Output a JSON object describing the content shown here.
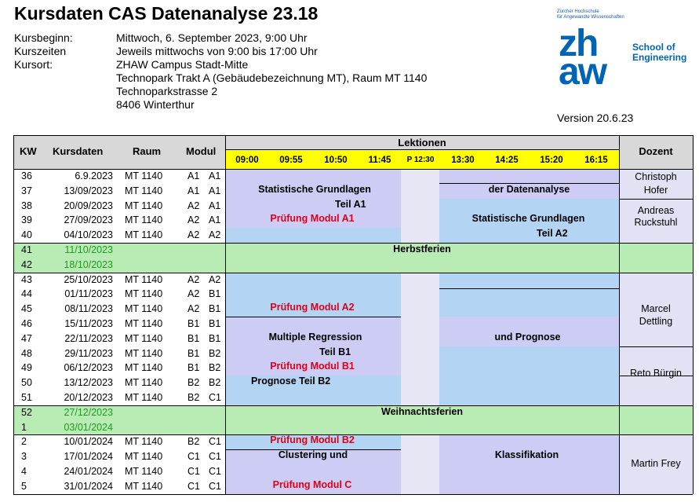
{
  "title": "Kursdaten CAS Datenanalyse 23.18",
  "info": [
    {
      "label": "Kursbeginn:",
      "value": "Mittwoch, 6. September 2023, 9:00 Uhr"
    },
    {
      "label": "Kurszeiten",
      "value": "Jeweils mittwochs von 9:00 bis 17:00 Uhr"
    },
    {
      "label": "Kursort:",
      "value": "ZHAW Campus Stadt-Mitte"
    },
    {
      "label": "",
      "value": "Technopark Trakt A (Gebäudebezeichnung MT), Raum MT 1140"
    },
    {
      "label": "",
      "value": "Technoparkstrasse 2"
    },
    {
      "label": "",
      "value": "8406 Winterthur"
    }
  ],
  "logo": {
    "small_line1": "Zürcher Hochschule",
    "small_line2": "für Angewandte Wissenschaften",
    "mark_top": "zh",
    "mark_bottom": "aw",
    "school_line1": "School of",
    "school_line2": "Engineering",
    "color": "#0064b4"
  },
  "version": "Version 20.6.23",
  "table": {
    "headers": {
      "kw": "KW",
      "kursdaten": "Kursdaten",
      "raum": "Raum",
      "modul": "Modul",
      "lektionen": "Lektionen",
      "dozent": "Dozent"
    },
    "times": [
      "09:00",
      "09:55",
      "10:50",
      "11:45",
      "P 12:30",
      "13:30",
      "14:25",
      "15:20",
      "16:15"
    ],
    "rows": [
      {
        "kw": "36",
        "date": "6.9.2023",
        "raum": "MT 1140",
        "m1": "A1",
        "m2": "A1"
      },
      {
        "kw": "37",
        "date": "13/09/2023",
        "raum": "MT 1140",
        "m1": "A1",
        "m2": "A1"
      },
      {
        "kw": "38",
        "date": "20/09/2023",
        "raum": "MT 1140",
        "m1": "A2",
        "m2": "A1"
      },
      {
        "kw": "39",
        "date": "27/09/2023",
        "raum": "MT 1140",
        "m1": "A2",
        "m2": "A1"
      },
      {
        "kw": "40",
        "date": "04/10/2023",
        "raum": "MT 1140",
        "m1": "A2",
        "m2": "A2"
      },
      {
        "kw": "41",
        "date": "11/10/2023",
        "raum": "",
        "m1": "",
        "m2": ""
      },
      {
        "kw": "42",
        "date": "18/10/2023",
        "raum": "",
        "m1": "",
        "m2": ""
      },
      {
        "kw": "43",
        "date": "25/10/2023",
        "raum": "MT 1140",
        "m1": "A2",
        "m2": "A2"
      },
      {
        "kw": "44",
        "date": "01/11/2023",
        "raum": "MT 1140",
        "m1": "A2",
        "m2": "B1"
      },
      {
        "kw": "45",
        "date": "08/11/2023",
        "raum": "MT 1140",
        "m1": "A2",
        "m2": "B1"
      },
      {
        "kw": "46",
        "date": "15/11/2023",
        "raum": "MT 1140",
        "m1": "B1",
        "m2": "B1"
      },
      {
        "kw": "47",
        "date": "22/11/2023",
        "raum": "MT 1140",
        "m1": "B1",
        "m2": "B1"
      },
      {
        "kw": "48",
        "date": "29/11/2023",
        "raum": "MT 1140",
        "m1": "B1",
        "m2": "B2"
      },
      {
        "kw": "49",
        "date": "06/12/2023",
        "raum": "MT 1140",
        "m1": "B1",
        "m2": "B2"
      },
      {
        "kw": "50",
        "date": "13/12/2023",
        "raum": "MT 1140",
        "m1": "B2",
        "m2": "B2"
      },
      {
        "kw": "51",
        "date": "20/12/2023",
        "raum": "MT 1140",
        "m1": "B2",
        "m2": "C1"
      },
      {
        "kw": "52",
        "date": "27/12/2023",
        "raum": "",
        "m1": "",
        "m2": ""
      },
      {
        "kw": "1",
        "date": "03/01/2024",
        "raum": "",
        "m1": "",
        "m2": ""
      },
      {
        "kw": "2",
        "date": "10/01/2024",
        "raum": "MT 1140",
        "m1": "B2",
        "m2": "C1"
      },
      {
        "kw": "3",
        "date": "17/01/2024",
        "raum": "MT 1140",
        "m1": "C1",
        "m2": "C1"
      },
      {
        "kw": "4",
        "date": "24/01/2024",
        "raum": "MT 1140",
        "m1": "C1",
        "m2": "C1"
      },
      {
        "kw": "5",
        "date": "31/01/2024",
        "raum": "MT 1140",
        "m1": "C1",
        "m2": "C1"
      }
    ],
    "events": {
      "stat_grundlagen": "Statistische Grundlagen",
      "teil_a1": "Teil A1",
      "pruef_a1": "Prüfung Modul A1",
      "der_datenanalyse": "der Datenanalyse",
      "stat_grundlagen2": "Statistische Grundlagen",
      "teil_a2": "Teil A2",
      "herbstferien": "Herbstferien",
      "pruef_a2": "Prüfung Modul A2",
      "multiple_regression": "Multiple Regression",
      "teil_b1": "Teil B1",
      "pruef_b1": "Prüfung Modul B1",
      "prognose_b2": "Prognose Teil B2",
      "und_prognose": "und Prognose",
      "weihnachtsferien": "Weihnachtsferien",
      "pruef_b2": "Prüfung Modul B2",
      "clustering": "Clustering und",
      "klassifikation": "Klassifikation",
      "pruef_c": "Prüfung Modul C"
    },
    "dozenten": {
      "d1a": "Christoph",
      "d1b": "Hofer",
      "d2a": "Andreas",
      "d2b": "Ruckstuhl",
      "d3a": "Marcel",
      "d3b": "Dettling",
      "d4": "Reto Bürgin",
      "d5": "Martin Frey"
    },
    "colors": {
      "header": "#d8d8d8",
      "time_bar": "#ffff00",
      "lavender": "#ccccf4",
      "blue": "#b4d4f4",
      "green": "#b8ecb4",
      "dozent": "#e2e2f4",
      "exam_red": "#e0001a",
      "holiday_text": "#1f9a1f"
    }
  }
}
